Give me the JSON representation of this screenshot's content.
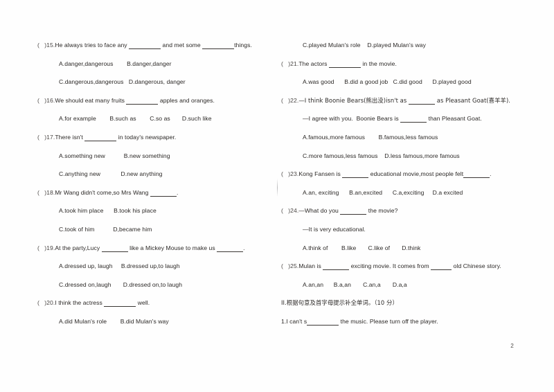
{
  "document": {
    "type": "english-exam-worksheet",
    "page_number": "2",
    "ink_color": "#2b2826"
  },
  "left_column": {
    "blocks": [
      {
        "kind": "question",
        "number": "15",
        "prefix": "(",
        "suffix": ")15.",
        "stem_a": "He always tries to face any ",
        "stem_b": " and met some ",
        "stem_c": "things.",
        "blank1": "b-md",
        "blank2": "b-md"
      },
      {
        "kind": "options",
        "text": "A.danger,dangerous        B.danger,danger"
      },
      {
        "kind": "options",
        "text": "C.dangerous,dangerous   D.dangerous, danger"
      },
      {
        "kind": "question",
        "number": "16",
        "prefix": "(",
        "suffix": ")16.",
        "stem_a": "We should eat many fruits ",
        "stem_b": " apples and oranges.",
        "stem_c": "",
        "blank1": "b-md",
        "blank2": null
      },
      {
        "kind": "options",
        "text": "A.for example        B.such as        C.so as       D.such like"
      },
      {
        "kind": "question",
        "number": "17",
        "prefix": "(",
        "suffix": ")17.",
        "stem_a": "There isn't ",
        "stem_b": " in today's newspaper.",
        "stem_c": "",
        "blank1": "b-md",
        "blank2": null
      },
      {
        "kind": "options",
        "text": "A.something new           B.new something"
      },
      {
        "kind": "options",
        "text": "C.anything new            D.new anything"
      },
      {
        "kind": "question",
        "number": "18",
        "prefix": "(",
        "suffix": ")18.",
        "stem_a": "Mr Wang didn't come,so Mrs Wang ",
        "stem_b": ".",
        "stem_c": "",
        "blank1": "b-sm",
        "blank2": null
      },
      {
        "kind": "options",
        "text": "A.took him place      B.took his place"
      },
      {
        "kind": "options",
        "text": "C.took of him           D,became him"
      },
      {
        "kind": "question",
        "number": "19",
        "prefix": "(",
        "suffix": ")19.",
        "stem_a": "At the party,Lucy ",
        "stem_b": " like a Mickey Mouse to make us ",
        "stem_c": ".",
        "blank1": "b-sm",
        "blank2": "b-sm"
      },
      {
        "kind": "options",
        "text": "A.dressed up, laugh     B.dressed up,to laugh"
      },
      {
        "kind": "options",
        "text": "C.dressed on,laugh       D.dressed on,to laugh"
      },
      {
        "kind": "question",
        "number": "20",
        "prefix": "(",
        "suffix": ")20.",
        "stem_a": "I think the actress ",
        "stem_b": " well.",
        "stem_c": "",
        "blank1": "b-md",
        "blank2": null
      },
      {
        "kind": "options",
        "text": "A.did Mulan's role        B.did Mulan's way"
      }
    ]
  },
  "right_column": {
    "blocks": [
      {
        "kind": "options",
        "text": "C.played Mulan's role    D.played Mulan's way"
      },
      {
        "kind": "question",
        "number": "21",
        "prefix": "(",
        "suffix": ")21.",
        "stem_a": "The actors ",
        "stem_b": " in the movie.",
        "stem_c": "",
        "blank1": "b-md",
        "blank2": null
      },
      {
        "kind": "options",
        "text": "A.was good      B.did a good job   C.did good      D.played good"
      },
      {
        "kind": "question",
        "number": "22",
        "prefix": "(",
        "suffix": ")22.",
        "stem_a": "—I think Boonie Bears(熊出没)isn't as ",
        "stem_b": " as Pleasant Goat(喜羊羊).",
        "stem_c": "",
        "blank1": "b-sm",
        "blank2": null
      },
      {
        "kind": "continuation",
        "stem_a": "—I agree with you.  Boonie Bears is ",
        "stem_b": " than Pleasant Goat.",
        "blank1": "b-sm"
      },
      {
        "kind": "options",
        "text": "A.famous,more famous        B.famous,less famous"
      },
      {
        "kind": "options",
        "text": "C.more famous,less famous    D.less famous,more famous"
      },
      {
        "kind": "question",
        "number": "23",
        "prefix": "(",
        "suffix": ")23.",
        "stem_a": "Kong Fansen is ",
        "stem_b": " educational movie,most people felt",
        "stem_c": ".",
        "blank1": "b-sm",
        "blank2": "b-sm"
      },
      {
        "kind": "options",
        "text": "A.an, exciting      B.an,excited      C.a,exciting     D.a excited"
      },
      {
        "kind": "question",
        "number": "24",
        "prefix": "(",
        "suffix": ")24.",
        "stem_a": "—What do you ",
        "stem_b": " the movie?",
        "stem_c": "",
        "blank1": "b-sm",
        "blank2": null
      },
      {
        "kind": "continuation",
        "stem_a": "—It is very educational.",
        "stem_b": "",
        "blank1": null
      },
      {
        "kind": "options",
        "text": "A.think of        B.like       C.like of       D.think"
      },
      {
        "kind": "question",
        "number": "25",
        "prefix": "(",
        "suffix": ")25.",
        "stem_a": "Mulan is ",
        "stem_b": " exciting movie. It comes from ",
        "stem_c": " old Chinese story.",
        "blank1": "b-sm",
        "blank2": "b-xs"
      },
      {
        "kind": "options",
        "text": "A.an,an      B.a,an       C.an,a       D.a,a"
      },
      {
        "kind": "section_heading",
        "text": "II.根据句意及首字母提示补全单词。（10 分）"
      },
      {
        "kind": "fill_in",
        "stem_a": "1.I can't s",
        "stem_b": " the music. Please turn off the player.",
        "blank1": "b-md"
      }
    ]
  }
}
